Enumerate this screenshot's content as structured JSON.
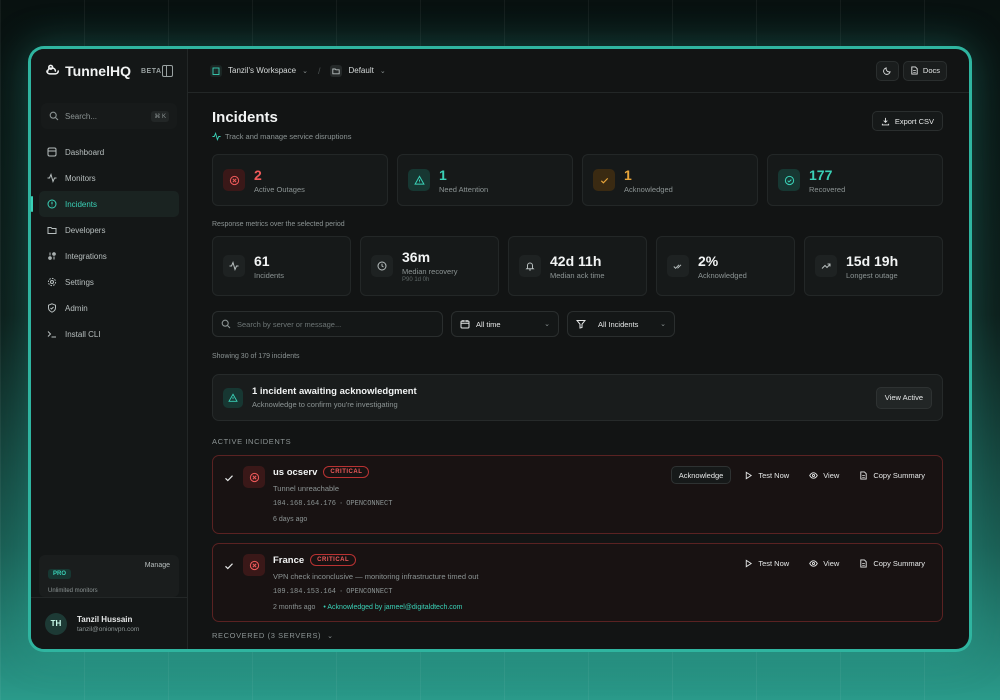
{
  "app": {
    "name": "TunnelHQ",
    "badge": "BETA"
  },
  "sidebar": {
    "search_placeholder": "Search...",
    "search_kbd": "⌘ K",
    "items": [
      {
        "label": "Dashboard",
        "icon": "dashboard-icon"
      },
      {
        "label": "Monitors",
        "icon": "activity-icon"
      },
      {
        "label": "Incidents",
        "icon": "alert-circle-icon",
        "active": true
      },
      {
        "label": "Developers",
        "icon": "folder-code-icon"
      },
      {
        "label": "Integrations",
        "icon": "integrations-icon"
      },
      {
        "label": "Settings",
        "icon": "gear-icon"
      },
      {
        "label": "Admin",
        "icon": "shield-icon"
      },
      {
        "label": "Install CLI",
        "icon": "terminal-icon"
      }
    ],
    "plan": {
      "badge": "PRO",
      "manage": "Manage",
      "note": "Unlimited monitors"
    },
    "user": {
      "initials": "TH",
      "name": "Tanzil Hussain",
      "email": "tanzil@onionvpn.com"
    }
  },
  "topbar": {
    "workspace": "Tanzil's Workspace",
    "separator": "/",
    "project": "Default",
    "docs": "Docs"
  },
  "page": {
    "title": "Incidents",
    "subtitle": "Track and manage service disruptions",
    "export": "Export CSV"
  },
  "stats": [
    {
      "value": "2",
      "label": "Active Outages",
      "color": "#ef5a5a"
    },
    {
      "value": "1",
      "label": "Need Attention",
      "color": "#3ad1b7"
    },
    {
      "value": "1",
      "label": "Acknowledged",
      "color": "#e8a53a"
    },
    {
      "value": "177",
      "label": "Recovered",
      "color": "#3ad1b7"
    }
  ],
  "metrics_note": "Response metrics over the selected period",
  "metrics": [
    {
      "value": "61",
      "label": "Incidents",
      "sub": ""
    },
    {
      "value": "36m",
      "label": "Median recovery",
      "sub": "P90 1d 0h"
    },
    {
      "value": "42d 11h",
      "label": "Median ack time",
      "sub": ""
    },
    {
      "value": "2%",
      "label": "Acknowledged",
      "sub": ""
    },
    {
      "value": "15d 19h",
      "label": "Longest outage",
      "sub": ""
    }
  ],
  "filters": {
    "search_placeholder": "Search by server or message...",
    "time": "All time",
    "status": "All Incidents"
  },
  "showing": "Showing 30 of 179 incidents",
  "awaiting": {
    "title": "1 incident awaiting acknowledgment",
    "subtitle": "Acknowledge to confirm you're investigating",
    "button": "View Active"
  },
  "active_header": "ACTIVE INCIDENTS",
  "incidents": [
    {
      "name": "us ocserv",
      "severity": "CRITICAL",
      "message": "Tunnel unreachable",
      "ip": "104.168.164.176",
      "protocol": "OPENCONNECT",
      "time": "6 days ago",
      "acked_by": "",
      "actions": {
        "ack": "Acknowledge",
        "test": "Test Now",
        "view": "View",
        "copy": "Copy Summary"
      }
    },
    {
      "name": "France",
      "severity": "CRITICAL",
      "message": "VPN check inconclusive — monitoring infrastructure timed out",
      "ip": "109.184.153.164",
      "protocol": "OPENCONNECT",
      "time": "2 months ago",
      "acked_by": "Acknowledged by jameel@digitaldtech.com",
      "actions": {
        "test": "Test Now",
        "view": "View",
        "copy": "Copy Summary"
      }
    }
  ],
  "recovered_header": "RECOVERED (3 SERVERS)"
}
